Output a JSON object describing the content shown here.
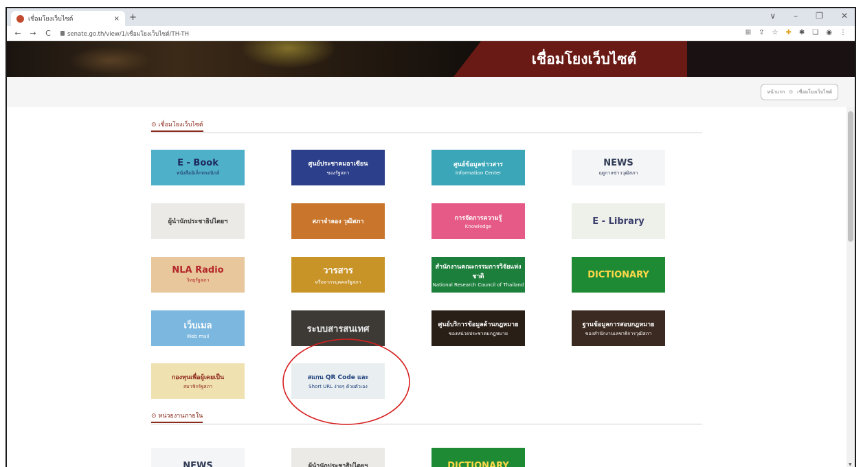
{
  "browser": {
    "tab_title": "เชื่อมโยงเว็บไซต์",
    "tab_close": "×",
    "new_tab": "+",
    "url": "senate.go.th/view/1/เชื่อมโยงเว็บไซต์/TH-TH",
    "controls": [
      "∨",
      "–",
      "❐",
      "✕"
    ],
    "nav": [
      "←",
      "→",
      "C"
    ],
    "extensions": [
      "⊞",
      "⇪",
      "☆",
      "✚",
      "✱",
      "❏",
      "◉",
      "⋮"
    ]
  },
  "banner": {
    "title": "เชื่อมโยงเว็บไซต์"
  },
  "breadcrumb": {
    "home": "หน้าแรก",
    "separator": "⊙",
    "current": "เชื่อมโยงเว็บไซต์"
  },
  "sections": [
    {
      "icon": "⊙",
      "title": "เชื่อมโยงเว็บไซต์"
    },
    {
      "icon": "⊙",
      "title": "หน่วยงานภายใน"
    }
  ],
  "tiles": [
    {
      "line1": "E - Book",
      "line2": "หนังสืออิเล็กทรอนิกส์",
      "bg": "#4fb0c9",
      "fg": "#1d2a60"
    },
    {
      "line1": "ศูนย์ประชาคมอาเซียน",
      "line2": "ของรัฐสภา",
      "bg": "#2c3f8a",
      "fg": "#ffffff"
    },
    {
      "line1": "ศูนย์ข้อมูลข่าวสาร",
      "line2": "Information Center",
      "bg": "#3aa6b7",
      "fg": "#ffffff"
    },
    {
      "line1": "NEWS",
      "line2": "ฤดูกาลข่าววุฒิสภา",
      "bg": "#f3f5f7",
      "fg": "#303a55"
    },
    {
      "line1": "ผู้นำนักประชาธิปไตยฯ",
      "line2": "",
      "bg": "#eceae6",
      "fg": "#333333"
    },
    {
      "line1": "สภาจำลอง วุฒิสภา",
      "line2": "",
      "bg": "#c9762c",
      "fg": "#ffffff"
    },
    {
      "line1": "การจัดการความรู้",
      "line2": "Knowledge",
      "bg": "#e55a86",
      "fg": "#ffffff"
    },
    {
      "line1": "E - Library",
      "line2": "",
      "bg": "#eef0ea",
      "fg": "#3a3f6b"
    },
    {
      "line1": "NLA Radio",
      "line2": "วิทยุรัฐสภา",
      "bg": "#e7c79b",
      "fg": "#b4262a"
    },
    {
      "line1": "วารสาร",
      "line2": "หรือจากรบุคคลรัฐสภา",
      "bg": "#c89327",
      "fg": "#ffffff"
    },
    {
      "line1": "สำนักงานคณะกรรมการวิจัยแห่งชาติ",
      "line2": "National Research Council of Thailand",
      "bg": "#1d7f3c",
      "fg": "#ffffff"
    },
    {
      "line1": "DICTIONARY",
      "line2": "",
      "bg": "#1e8a34",
      "fg": "#ffd84a"
    },
    {
      "line1": "เว็บเมล",
      "line2": "Web mail",
      "bg": "#7bb7df",
      "fg": "#ffffff"
    },
    {
      "line1": "ระบบสารสนเทศ",
      "line2": "",
      "bg": "#3d3a36",
      "fg": "#e8e8e8"
    },
    {
      "line1": "ศูนย์บริการข้อมูลด้านกฎหมาย",
      "line2": "ของหน่วยประชาคมกฎหมาย",
      "bg": "#2a1f17",
      "fg": "#ffffff"
    },
    {
      "line1": "ฐานข้อมูลการสอบกฎหมาย",
      "line2": "ของสำนักงานเลขาธิการวุฒิสภา",
      "bg": "#3b2a21",
      "fg": "#ffffff"
    },
    {
      "line1": "กองทุนเพื่อผู้เคยเป็น",
      "line2": "สมาชิกรัฐสภา",
      "bg": "#f0e1b1",
      "fg": "#8e2a1a"
    },
    {
      "line1": "สแกน QR Code และ",
      "line2": "Short URL ง่ายๆ ด้วยตัวเอง",
      "bg": "#e9eef0",
      "fg": "#1b3f7a"
    },
    {
      "line1": "NEWS",
      "line2": "",
      "bg": "#f3f5f7",
      "fg": "#303a55"
    },
    {
      "line1": "ผู้นำนักประชาธิปไตยฯ",
      "line2": "",
      "bg": "#eceae6",
      "fg": "#333333"
    },
    {
      "line1": "DICTIONARY",
      "line2": "",
      "bg": "#1e8a34",
      "fg": "#ffd84a"
    }
  ],
  "highlight_color": "#d62020"
}
